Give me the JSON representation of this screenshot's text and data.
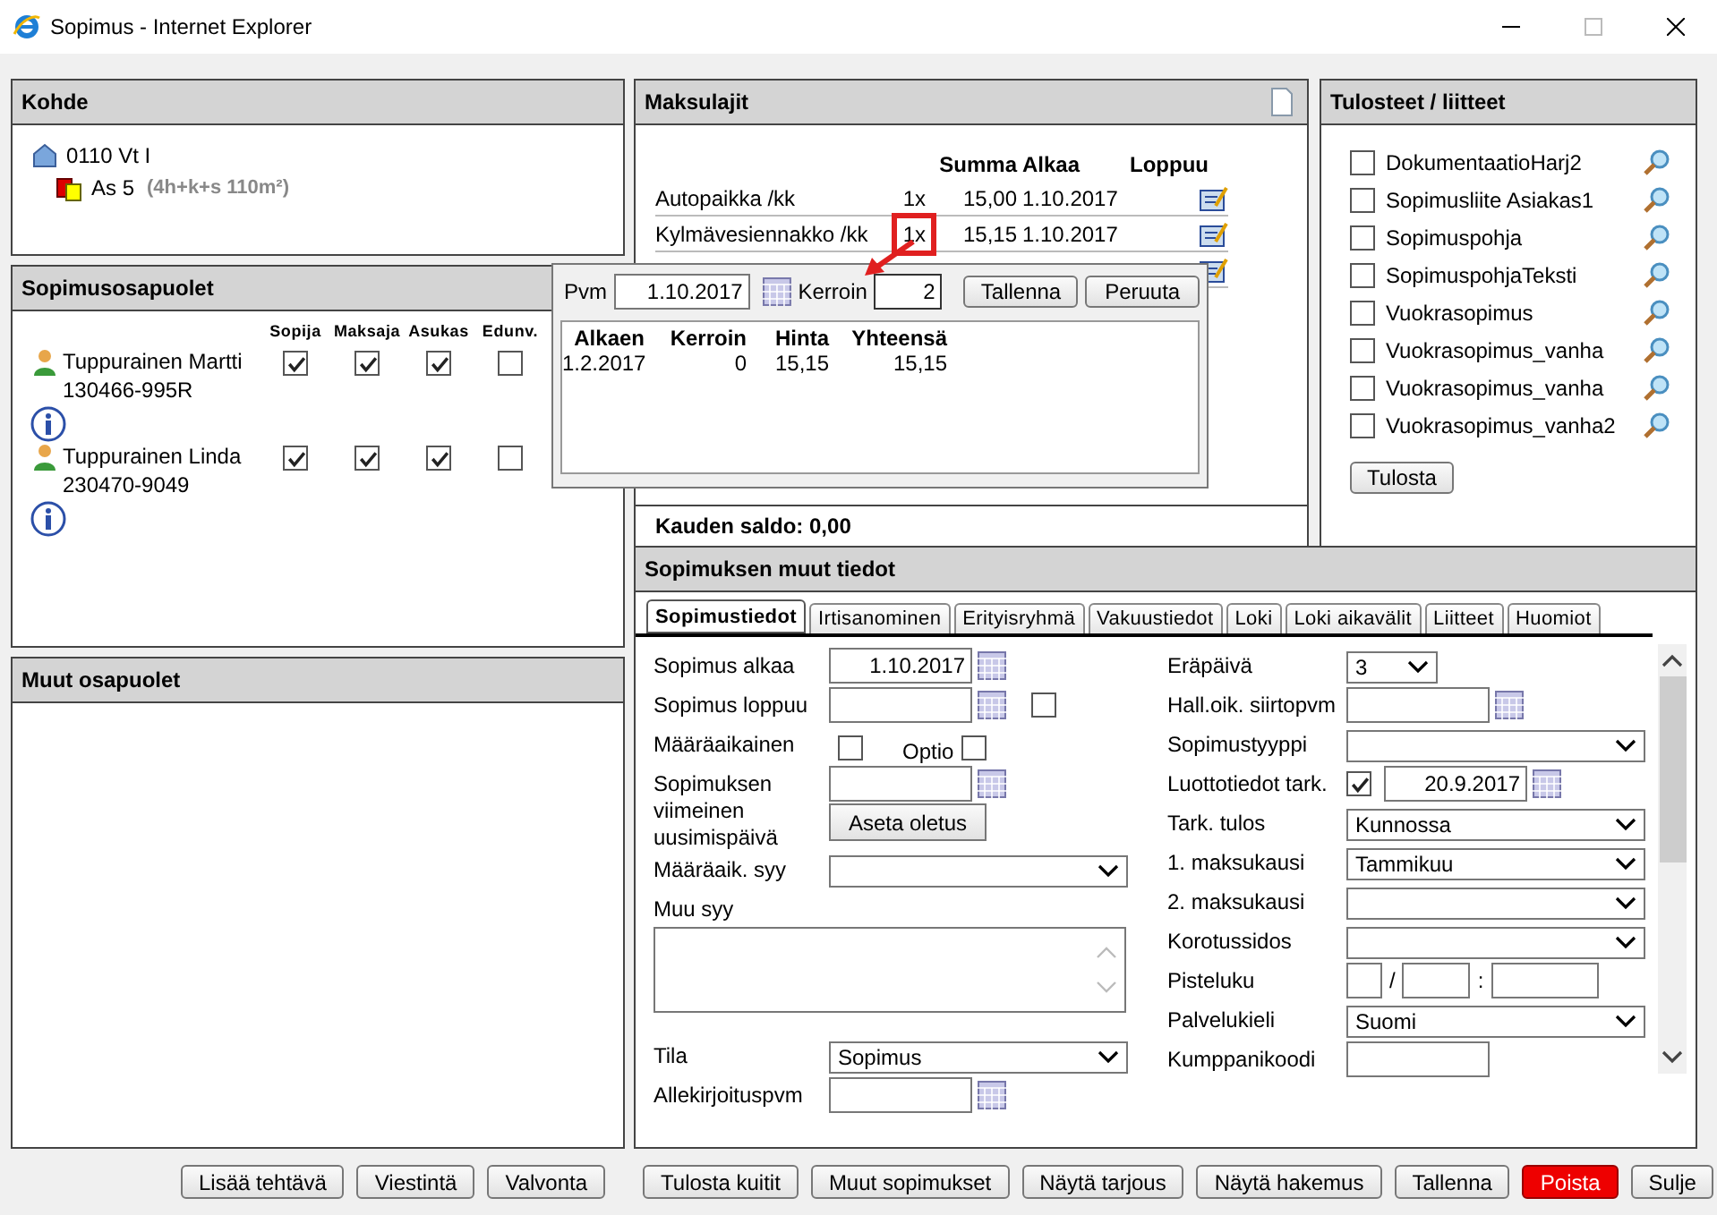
{
  "window": {
    "title": "Sopimus - Internet Explorer"
  },
  "kohde": {
    "title": "Kohde",
    "building": "0110 Vt I",
    "apartment": "As 5",
    "apartment_detail": "(4h+k+s  110m²)"
  },
  "parties": {
    "title": "Sopimusosapuolet",
    "columns": [
      "Sopija",
      "Maksaja",
      "Asukas",
      "Edunv."
    ],
    "rows": [
      {
        "name": "Tuppurainen Martti",
        "id": "130466-995R",
        "roles": [
          {
            "checked": true
          },
          {
            "checked": true
          },
          {
            "checked": true
          },
          {
            "checked": false
          }
        ]
      },
      {
        "name": "Tuppurainen Linda",
        "id": "230470-9049",
        "roles": [
          {
            "checked": true
          },
          {
            "checked": true
          },
          {
            "checked": true
          },
          {
            "checked": false
          }
        ]
      }
    ]
  },
  "other_parties": {
    "title": "Muut osapuolet"
  },
  "fees": {
    "title": "Maksulajit",
    "columns": [
      "Summa",
      "Alkaa",
      "Loppuu"
    ],
    "rows": [
      {
        "name": "Autopaikka /kk",
        "multiplier": "1x",
        "amount": "15,00",
        "start": "1.10.2017",
        "highlighted": false
      },
      {
        "name": "Kylmävesiennakko /kk",
        "multiplier": "1x",
        "amount": "15,15",
        "start": "1.10.2017",
        "highlighted": true
      }
    ],
    "balance": "Kauden saldo: 0,00"
  },
  "popup": {
    "date_label": "Pvm",
    "date": "1.10.2017",
    "factor_label": "Kerroin",
    "factor": "2",
    "buttons": [
      "Tallenna",
      "Peruuta"
    ],
    "columns": [
      "Alkaen",
      "Kerroin",
      "Hinta",
      "Yhteensä"
    ],
    "rows": [
      [
        "1.2.2017",
        "0",
        "15,15",
        "15,15"
      ]
    ]
  },
  "docs": {
    "title": "Tulosteet / liitteet",
    "items": [
      {
        "label": "DokumentaatioHarj2",
        "checked": false
      },
      {
        "label": "Sopimusliite Asiakas1",
        "checked": false
      },
      {
        "label": "Sopimuspohja",
        "checked": false
      },
      {
        "label": "SopimuspohjaTeksti",
        "checked": false
      },
      {
        "label": "Vuokrasopimus",
        "checked": false
      },
      {
        "label": "Vuokrasopimus_vanha",
        "checked": false
      },
      {
        "label": "Vuokrasopimus_vanha",
        "checked": false
      },
      {
        "label": "Vuokrasopimus_vanha2",
        "checked": false
      }
    ],
    "button": "Tulosta"
  },
  "details": {
    "title": "Sopimuksen muut tiedot",
    "tabs": [
      {
        "label": "Sopimustiedot",
        "selected": true
      },
      {
        "label": "Irtisanominen",
        "selected": false
      },
      {
        "label": "Erityisryhmä",
        "selected": false
      },
      {
        "label": "Vakuustiedot",
        "selected": false
      },
      {
        "label": "Loki",
        "selected": false
      },
      {
        "label": "Loki aikavälit",
        "selected": false
      },
      {
        "label": "Liitteet",
        "selected": false
      },
      {
        "label": "Huomiot",
        "selected": false
      }
    ],
    "left_fields": [
      {
        "kind": "date",
        "label": "Sopimus alkaa",
        "value": "1.10.2017"
      },
      {
        "kind": "date_check",
        "label": "Sopimus loppuu",
        "checked": false
      },
      {
        "kind": "check_option",
        "label": "Määräaikainen",
        "checked": false,
        "option_label": "Optio",
        "option_checked": false
      },
      {
        "kind": "date_button",
        "label": "Sopimuksen viimeinen uusimispäivä",
        "button": "Aseta oletus"
      },
      {
        "kind": "select",
        "label": "Määräaik. syy"
      },
      {
        "kind": "textarea",
        "label": "Muu syy"
      },
      {
        "kind": "select",
        "label": "Tila",
        "value": "Sopimus"
      },
      {
        "kind": "date",
        "label": "Allekirjoituspvm"
      }
    ],
    "right_fields": [
      {
        "kind": "select_small",
        "label": "Eräpäivä",
        "value": "3"
      },
      {
        "kind": "date",
        "label": "Hall.oik. siirtopvm"
      },
      {
        "kind": "select",
        "label": "Sopimustyyppi"
      },
      {
        "kind": "check_date",
        "label": "Luottotiedot tark.",
        "checked": true,
        "value": "20.9.2017"
      },
      {
        "kind": "select",
        "label": "Tark. tulos",
        "value": "Kunnossa"
      },
      {
        "kind": "select",
        "label": "1. maksukausi",
        "value": "Tammikuu"
      },
      {
        "kind": "select",
        "label": "2. maksukausi"
      },
      {
        "kind": "select",
        "label": "Korotussidos"
      },
      {
        "kind": "score",
        "label": "Pisteluku",
        "separators": [
          "/",
          ":"
        ]
      },
      {
        "kind": "select",
        "label": "Palvelukieli",
        "value": "Suomi"
      },
      {
        "kind": "text",
        "label": "Kumppanikoodi"
      }
    ]
  },
  "footer_groups": [
    [
      {
        "label": "Lisää tehtävä",
        "kind": "normal"
      },
      {
        "label": "Viestintä",
        "kind": "normal"
      },
      {
        "label": "Valvonta",
        "kind": "normal"
      }
    ],
    [
      {
        "label": "Tulosta kuitit",
        "kind": "normal"
      },
      {
        "label": "Muut sopimukset",
        "kind": "normal"
      },
      {
        "label": "Näytä tarjous",
        "kind": "normal"
      },
      {
        "label": "Näytä hakemus",
        "kind": "normal"
      },
      {
        "label": "Tallenna",
        "kind": "normal"
      },
      {
        "label": "Poista",
        "kind": "danger"
      },
      {
        "label": "Sulje",
        "kind": "normal"
      }
    ]
  ]
}
